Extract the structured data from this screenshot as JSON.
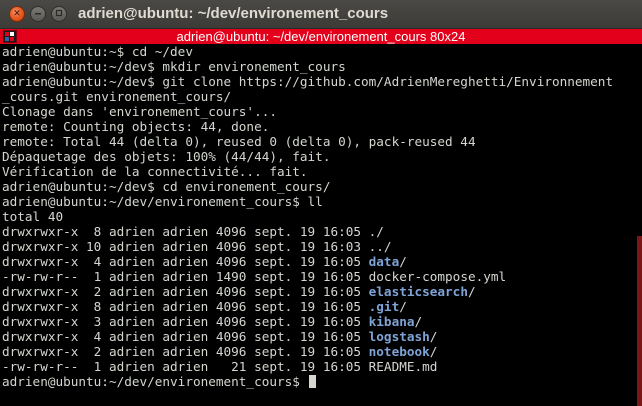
{
  "window": {
    "title": "adrien@ubuntu: ~/dev/environement_cours",
    "banner_title": "adrien@ubuntu: ~/dev/environement_cours 80x24",
    "close_glyph": "✕",
    "colors": {
      "titlebar": "#3c3b37",
      "banner": "#e3001b",
      "background": "#000000",
      "text": "#d3d7cf",
      "directory": "#7ea3d6"
    }
  },
  "terminal": {
    "lines": [
      "adrien@ubuntu:~$ cd ~/dev",
      "adrien@ubuntu:~/dev$ mkdir environement_cours",
      "adrien@ubuntu:~/dev$ git clone https://github.com/AdrienMereghetti/Environnement",
      "_cours.git environement_cours/",
      "Clonage dans 'environement_cours'...",
      "remote: Counting objects: 44, done.",
      "remote: Total 44 (delta 0), reused 0 (delta 0), pack-reused 44",
      "Dépaquetage des objets: 100% (44/44), fait.",
      "Vérification de la connectivité... fait.",
      "adrien@ubuntu:~/dev$ cd environement_cours/",
      "adrien@ubuntu:~/dev/environement_cours$ ll",
      "total 40"
    ],
    "listing": [
      {
        "meta": "drwxrwxr-x  8 adrien adrien 4096 sept. 19 16:05 ",
        "name": "./",
        "is_dir": false
      },
      {
        "meta": "drwxrwxr-x 10 adrien adrien 4096 sept. 19 16:03 ",
        "name": "../",
        "is_dir": false
      },
      {
        "meta": "drwxrwxr-x  4 adrien adrien 4096 sept. 19 16:05 ",
        "name": "data",
        "suffix": "/",
        "is_dir": true
      },
      {
        "meta": "-rw-rw-r--  1 adrien adrien 1490 sept. 19 16:05 ",
        "name": "docker-compose.yml",
        "is_dir": false
      },
      {
        "meta": "drwxrwxr-x  2 adrien adrien 4096 sept. 19 16:05 ",
        "name": "elasticsearch",
        "suffix": "/",
        "is_dir": true
      },
      {
        "meta": "drwxrwxr-x  8 adrien adrien 4096 sept. 19 16:05 ",
        "name": ".git",
        "suffix": "/",
        "is_dir": true
      },
      {
        "meta": "drwxrwxr-x  3 adrien adrien 4096 sept. 19 16:05 ",
        "name": "kibana",
        "suffix": "/",
        "is_dir": true
      },
      {
        "meta": "drwxrwxr-x  4 adrien adrien 4096 sept. 19 16:05 ",
        "name": "logstash",
        "suffix": "/",
        "is_dir": true
      },
      {
        "meta": "drwxrwxr-x  2 adrien adrien 4096 sept. 19 16:05 ",
        "name": "notebook",
        "suffix": "/",
        "is_dir": true
      },
      {
        "meta": "-rw-rw-r--  1 adrien adrien   21 sept. 19 16:05 ",
        "name": "README.md",
        "is_dir": false
      }
    ],
    "prompt": "adrien@ubuntu:~/dev/environement_cours$ "
  }
}
